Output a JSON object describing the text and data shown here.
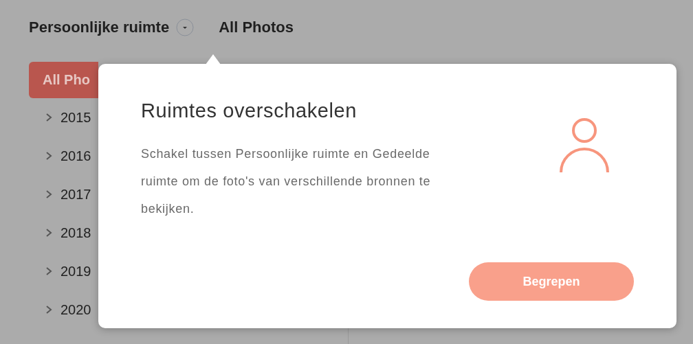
{
  "header": {
    "space_label": "Persoonlijke ruimte",
    "title": "All Photos"
  },
  "sidebar": {
    "items": [
      {
        "label": "All Pho",
        "kind": "pill",
        "selected": true
      },
      {
        "label": "2015",
        "kind": "year",
        "selected": false,
        "expanded": false
      },
      {
        "label": "2016",
        "kind": "year",
        "selected": false,
        "expanded": false
      },
      {
        "label": "2017",
        "kind": "year",
        "selected": false,
        "expanded": false
      },
      {
        "label": "2018",
        "kind": "year",
        "selected": false,
        "expanded": false
      },
      {
        "label": "2019",
        "kind": "year",
        "selected": false,
        "expanded": false
      },
      {
        "label": "2020",
        "kind": "year",
        "selected": false,
        "expanded": false
      }
    ]
  },
  "popover": {
    "title": "Ruimtes overschakelen",
    "body": "Schakel tussen Persoonlijke ruimte en Gedeelde ruimte om de foto's van verschillende bronnen te bekijken.",
    "button": "Begrepen"
  }
}
